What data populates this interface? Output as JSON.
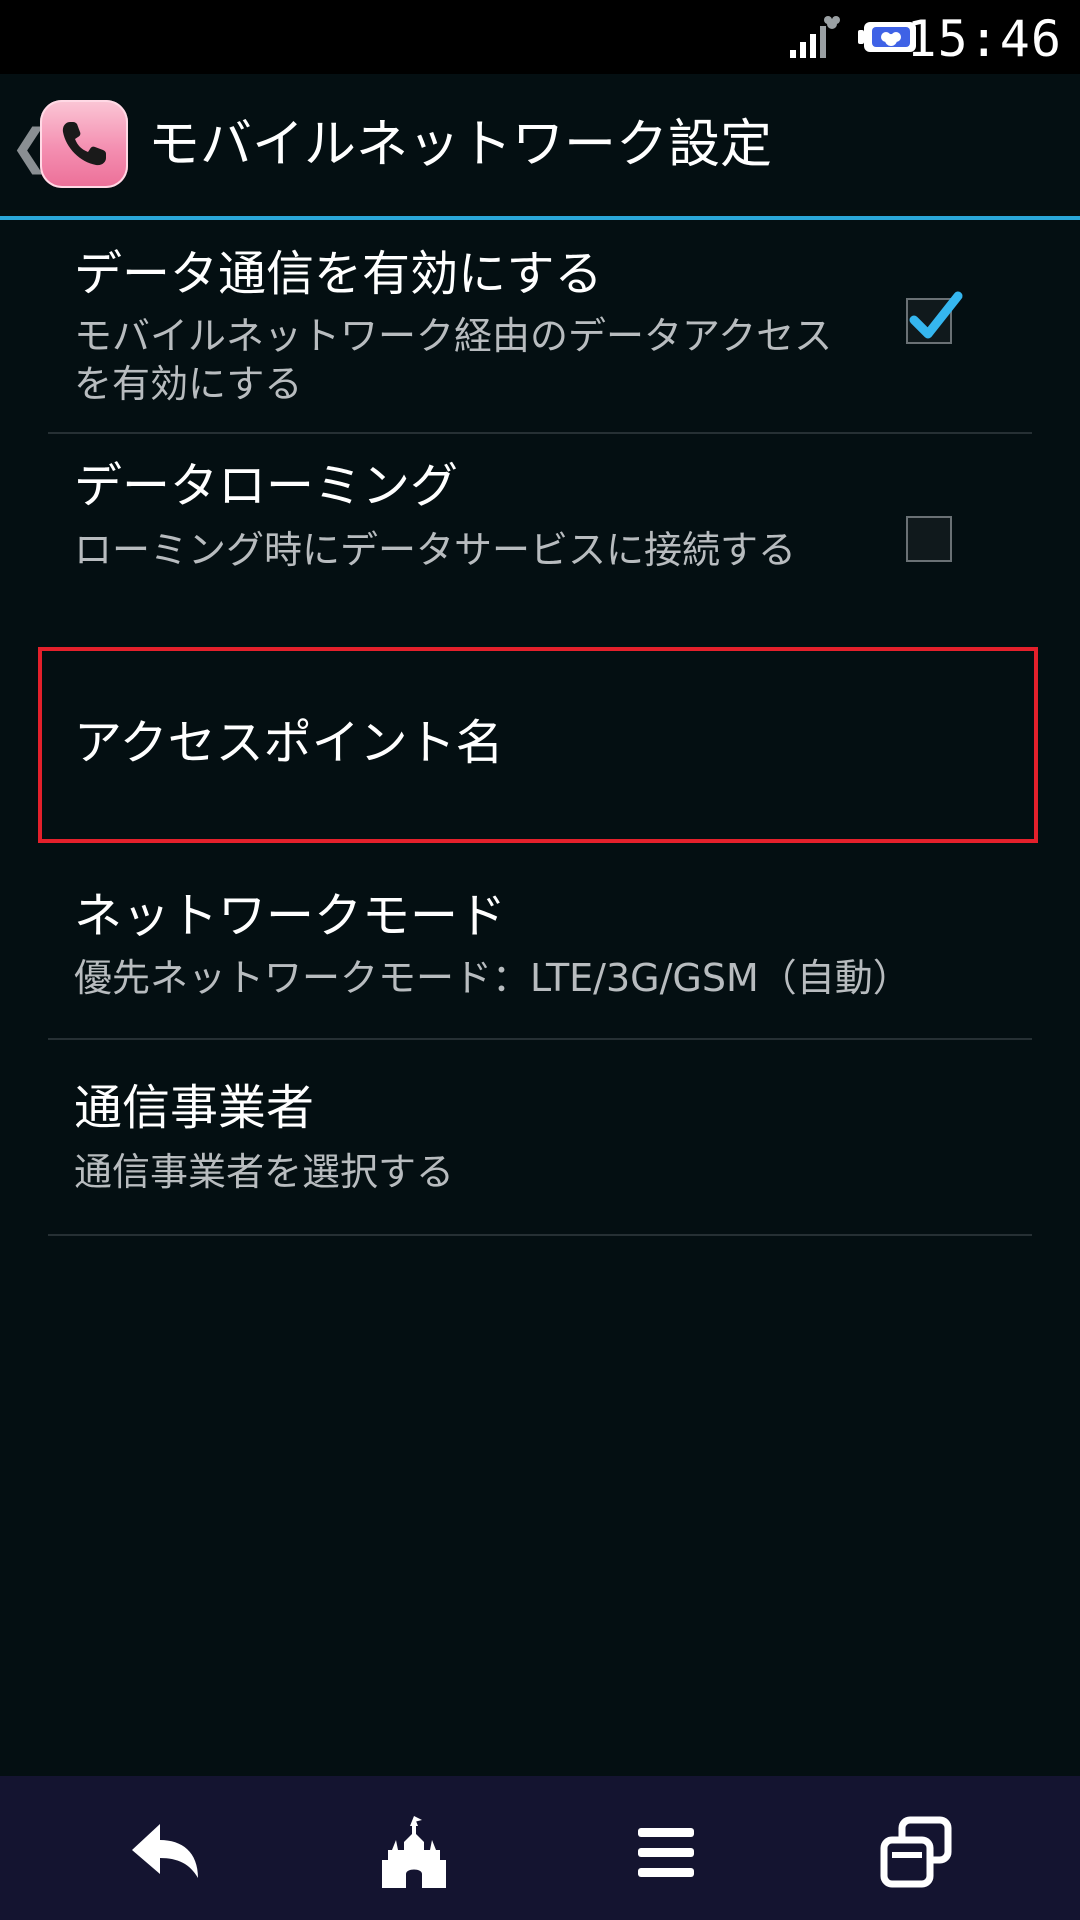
{
  "status_bar": {
    "time": "15:46",
    "icons": [
      "signal-icon",
      "battery-icon"
    ]
  },
  "action_bar": {
    "title": "モバイルネットワーク設定",
    "app_icon": "phone-icon",
    "back_icon": "back-caret-icon"
  },
  "settings": {
    "data_enabled": {
      "title": "データ通信を有効にする",
      "summary": "モバイルネットワーク経由のデータアクセスを有効にする",
      "checked": true
    },
    "data_roaming": {
      "title": "データローミング",
      "summary": "ローミング時にデータサービスに接続する",
      "checked": false
    },
    "access_point_names": {
      "title": "アクセスポイント名"
    },
    "network_mode": {
      "title": "ネットワークモード",
      "summary": "優先ネットワークモード：LTE/3G/GSM（自動）"
    },
    "network_operators": {
      "title": "通信事業者",
      "summary": "通信事業者を選択する"
    }
  },
  "colors": {
    "accent": "#2aa7d9",
    "highlight": "#e4202b",
    "background": "#040f12",
    "nav_background": "#141430"
  },
  "nav_bar": {
    "buttons": [
      "back-arrow-icon",
      "castle-icon",
      "menu-icon",
      "recent-apps-icon"
    ]
  }
}
